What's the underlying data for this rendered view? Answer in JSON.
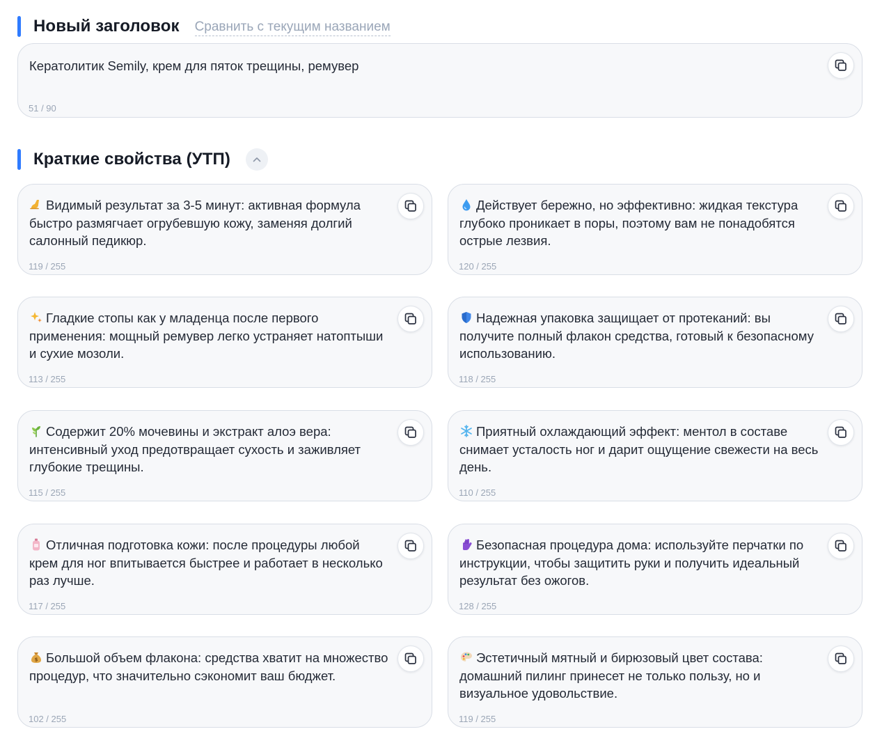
{
  "title_section": {
    "heading": "Новый заголовок",
    "compare_link": "Сравнить с текущим названием",
    "value": "Кератолитик Semily, крем для пяток трещины, ремувер",
    "counter": "51 / 90"
  },
  "utp_section": {
    "heading": "Краткие свойства (УТП)",
    "cards": [
      {
        "icon": "foot-icon",
        "text": "Видимый результат за 3-5 минут: активная формула быстро размягчает огрубевшую кожу, заменяя долгий салонный педикюр.",
        "counter": "119 / 255"
      },
      {
        "icon": "droplet-icon",
        "text": "Действует бережно, но эффективно: жидкая текстура глубоко проникает в поры, поэтому вам не понадобятся острые лезвия.",
        "counter": "120 / 255"
      },
      {
        "icon": "sparkles-icon",
        "text": "Гладкие стопы как у младенца после первого применения: мощный ремувер легко устраняет натоптыши и сухие мозоли.",
        "counter": "113 / 255"
      },
      {
        "icon": "shield-icon",
        "text": "Надежная упаковка защищает от протеканий: вы получите полный флакон средства, готовый к безопасному использованию.",
        "counter": "118 / 255"
      },
      {
        "icon": "herb-icon",
        "text": "Содержит 20% мочевины и экстракт алоэ вера: интенсивный уход предотвращает сухость и заживляет глубокие трещины.",
        "counter": "115 / 255"
      },
      {
        "icon": "snowflake-icon",
        "text": "Приятный охлаждающий эффект: ментол в составе снимает усталость ног и дарит ощущение свежести на весь день.",
        "counter": "110 / 255"
      },
      {
        "icon": "lotion-bottle-icon",
        "text": "Отличная подготовка кожи: после процедуры любой крем для ног впитывается быстрее и работает в несколько раз лучше.",
        "counter": "117 / 255"
      },
      {
        "icon": "gloves-icon",
        "text": "Безопасная процедура дома: используйте перчатки по инструкции, чтобы защитить руки и получить идеальный результат без ожогов.",
        "counter": "128 / 255"
      },
      {
        "icon": "money-bag-icon",
        "text": "Большой объем флакона: средства хватит на множество процедур, что значительно сэкономит ваш бюджет.",
        "counter": "102 / 255"
      },
      {
        "icon": "palette-icon",
        "text": "Эстетичный мятный и бирюзовый цвет состава: домашний пилинг принесет не только пользу, но и визуальное удовольствие.",
        "counter": "119 / 255"
      }
    ]
  },
  "colors": {
    "accent": "#2f7bff",
    "card_bg": "#f7f8fa",
    "card_border": "#d9dee6",
    "muted_text": "#9ba6b6"
  }
}
